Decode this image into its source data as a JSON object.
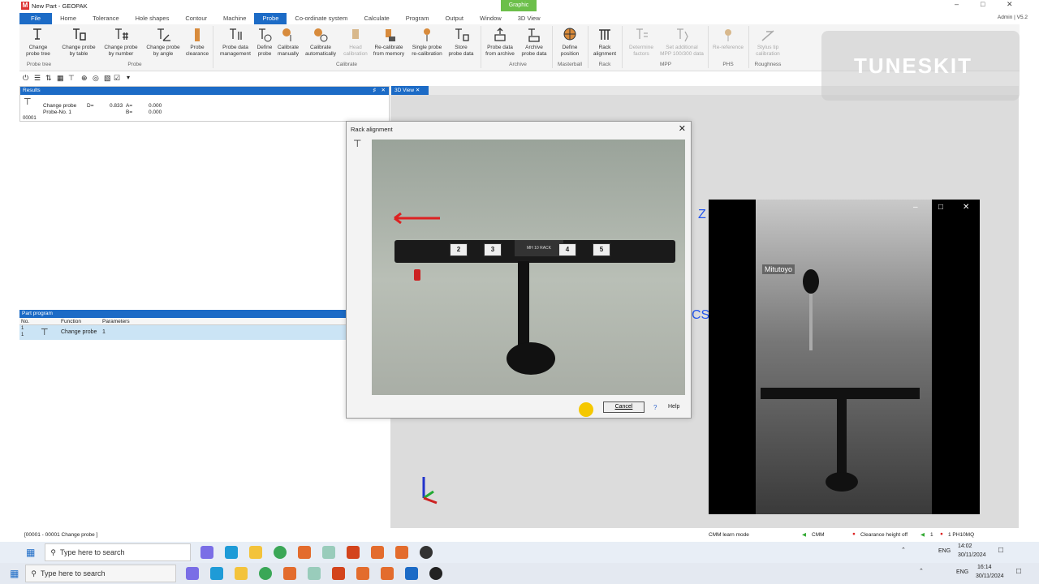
{
  "window": {
    "title": "New Part - GEOPAK",
    "context_tab": "Graphic",
    "user": "Admin | V5.2"
  },
  "menu": [
    "File",
    "Home",
    "Tolerance",
    "Hole shapes",
    "Contour",
    "Machine",
    "Probe",
    "Co-ordinate system",
    "Calculate",
    "Program",
    "Output",
    "Window",
    "3D View"
  ],
  "ribbon": {
    "buttons": [
      {
        "l1": "Change",
        "l2": "probe tree"
      },
      {
        "l1": "Change probe",
        "l2": "by table"
      },
      {
        "l1": "Change probe",
        "l2": "by number"
      },
      {
        "l1": "Change probe",
        "l2": "by angle"
      },
      {
        "l1": "Probe",
        "l2": "clearance"
      },
      {
        "l1": "Probe data",
        "l2": "management"
      },
      {
        "l1": "Define",
        "l2": "probe"
      },
      {
        "l1": "Calibrate",
        "l2": "manually"
      },
      {
        "l1": "Calibrate",
        "l2": "automatically"
      },
      {
        "l1": "Head",
        "l2": "calibration"
      },
      {
        "l1": "Re-calibrate",
        "l2": "from memory"
      },
      {
        "l1": "Single probe",
        "l2": "re-calibration"
      },
      {
        "l1": "Store",
        "l2": "probe data"
      },
      {
        "l1": "Probe data",
        "l2": "from archive"
      },
      {
        "l1": "Archive",
        "l2": "probe data"
      },
      {
        "l1": "Define",
        "l2": "position"
      },
      {
        "l1": "Rack",
        "l2": "alignment"
      },
      {
        "l1": "Determine",
        "l2": "factors"
      },
      {
        "l1": "Set additional",
        "l2": "MPP 100/300 data"
      },
      {
        "l1": "Re-reference",
        "l2": ""
      },
      {
        "l1": "Stylus tip",
        "l2": "calibration"
      }
    ],
    "groups": [
      "Probe tree",
      "Probe",
      "Calibrate",
      "Archive",
      "Masterball",
      "Rack",
      "MPP",
      "PHS",
      "Roughness"
    ]
  },
  "results": {
    "header": "Results",
    "row": {
      "icon_num": "00001",
      "fn": "Change probe",
      "probe_no": "Probe-No.  1",
      "d_label": "D=",
      "d_val": "0.833",
      "a_label": "A=",
      "a_val": "0.000",
      "b_label": "B=",
      "b_val": "0.000"
    }
  },
  "part_program": {
    "header": "Part program",
    "columns": [
      "No.",
      "Function",
      "Parameters"
    ],
    "row": {
      "no": "1",
      "no2": "1",
      "fn": "Change probe",
      "param": "1"
    }
  },
  "view3d": {
    "tab": "3D View",
    "axis_z": "Z",
    "axis_cs": "CS"
  },
  "dialog": {
    "title": "Rack alignment",
    "cancel": "Cancel",
    "help": "Help",
    "slots": [
      "2",
      "3",
      "4",
      "5"
    ],
    "slot_label": "MH 10 RACK"
  },
  "video": {
    "brand": "Mitutoyo"
  },
  "statusbar": {
    "left": "[00001 - 00001 Change probe ]",
    "mode": "CMM learn mode",
    "cmm": "CMM",
    "clearance": "Clearance height off",
    "count": "1",
    "probe": "1 PH10MQ"
  },
  "taskbar1": {
    "search": "Type here to search",
    "lang": "ENG",
    "time": "14:02",
    "date": "30/11/2024"
  },
  "taskbar2": {
    "search": "Type here to search",
    "lang": "ENG",
    "time": "16:14",
    "date": "30/11/2024"
  },
  "watermark": "TUNESKIT",
  "colors": {
    "accent": "#1c6bc6",
    "graphic_tab": "#6cbf4a"
  }
}
